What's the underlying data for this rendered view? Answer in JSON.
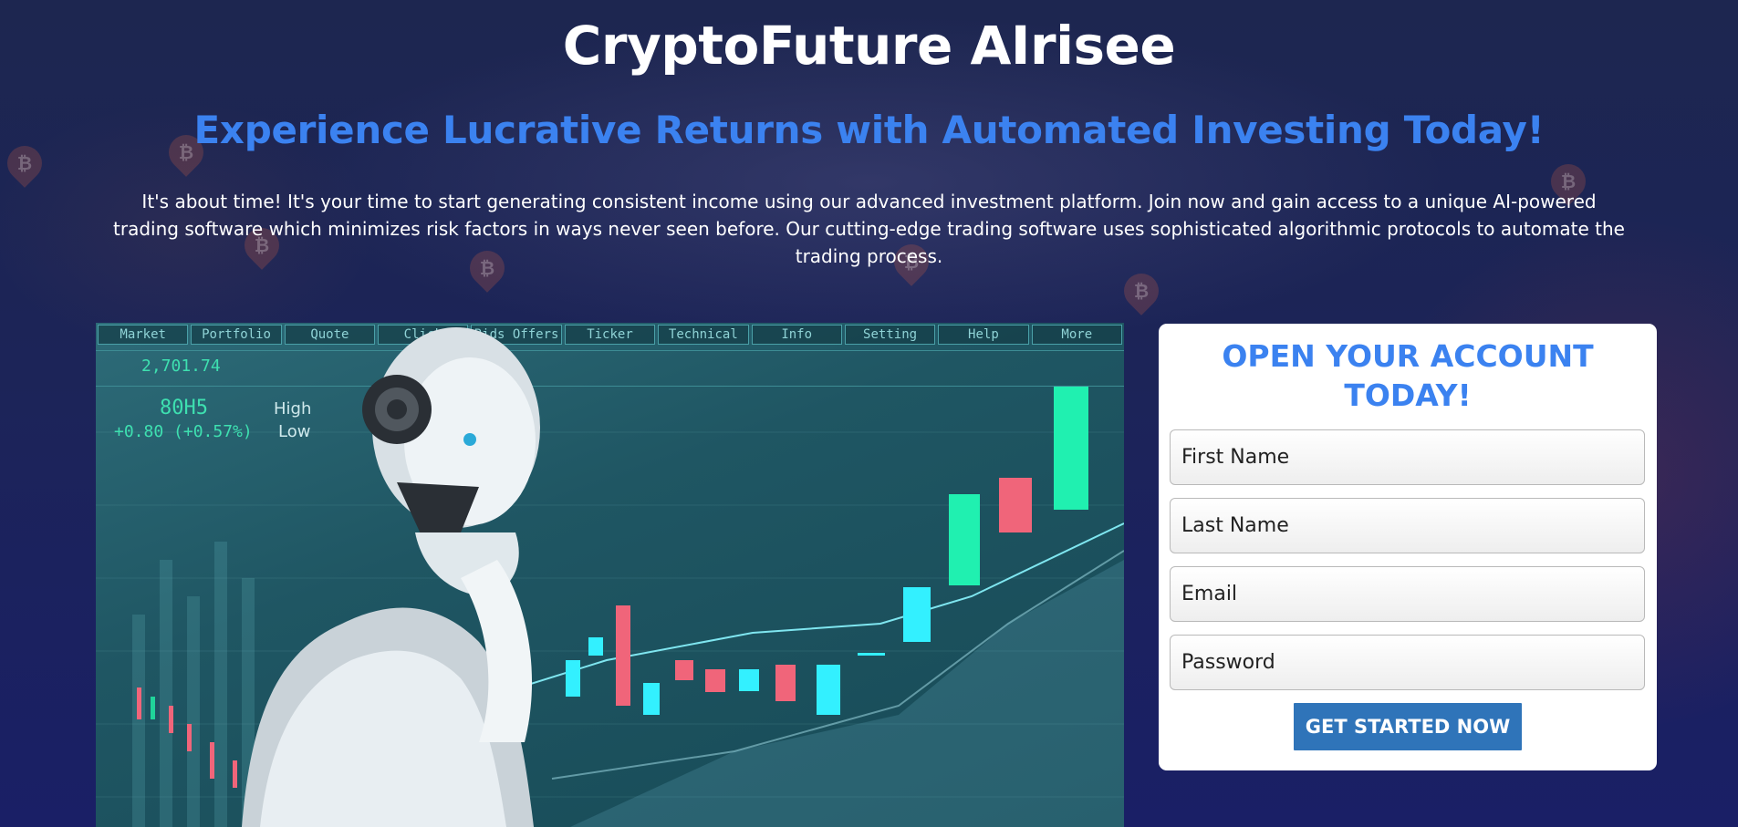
{
  "header": {
    "title": "CryptoFuture AIrisee",
    "subtitle": "Experience Lucrative Returns with Automated Investing Today!",
    "description": "It's about time! It's your time to start generating consistent income using our advanced investment platform. Join now and gain access to a unique AI-powered trading software which minimizes risk factors in ways never seen before. Our cutting-edge trading software uses sophisticated algorithmic protocols to automate the trading process."
  },
  "hero": {
    "toolbar": [
      "Market",
      "Portfolio",
      "Quote",
      "Click",
      "Bids Offers",
      "Ticker",
      "Technical",
      "Info",
      "Setting",
      "Help",
      "More"
    ],
    "ticker_value": "2,701.74",
    "ticker_code": "80H5",
    "ticker_change": "+0.80 (+0.57%)",
    "high_label": "High",
    "low_label": "Low"
  },
  "form": {
    "heading": "OPEN YOUR ACCOUNT TODAY!",
    "first_name_placeholder": "First Name",
    "last_name_placeholder": "Last Name",
    "email_placeholder": "Email",
    "password_placeholder": "Password",
    "submit_label": "GET STARTED NOW"
  },
  "colors": {
    "accent": "#3b82f0",
    "button": "#2f74b9",
    "background": "#1c2458"
  }
}
